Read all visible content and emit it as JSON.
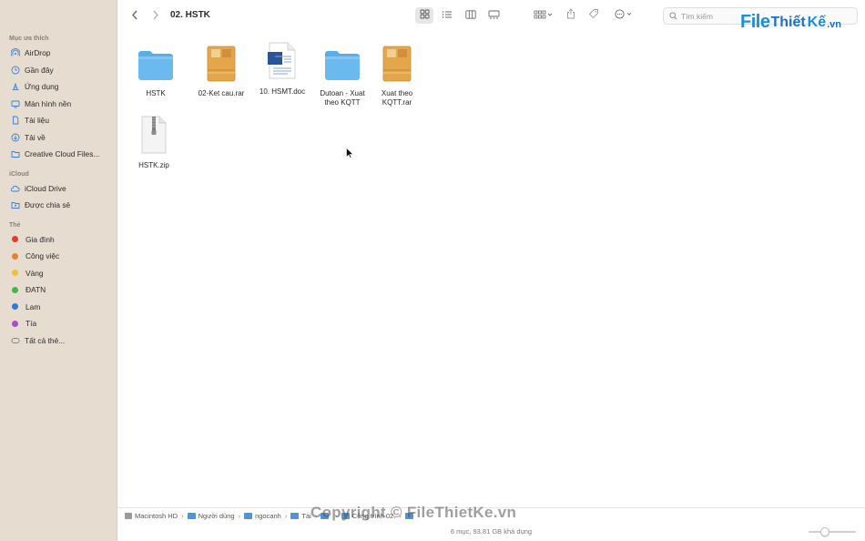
{
  "sidebar": {
    "favorites_heading": "Mục ưa thích",
    "favorites": [
      {
        "label": "AirDrop",
        "icon": "airdrop-icon"
      },
      {
        "label": "Gần đây",
        "icon": "clock-icon"
      },
      {
        "label": "Ứng dụng",
        "icon": "applications-icon"
      },
      {
        "label": "Màn hình nền",
        "icon": "desktop-icon"
      },
      {
        "label": "Tài liệu",
        "icon": "document-icon"
      },
      {
        "label": "Tải về",
        "icon": "download-icon"
      },
      {
        "label": "Creative Cloud Files...",
        "icon": "folder-icon"
      }
    ],
    "icloud_heading": "iCloud",
    "icloud": [
      {
        "label": "iCloud Drive",
        "icon": "cloud-icon"
      },
      {
        "label": "Được chia sẻ",
        "icon": "shared-folder-icon"
      }
    ],
    "tags_heading": "Thẻ",
    "tags": [
      {
        "label": "Gia đình",
        "color": "#e5392f"
      },
      {
        "label": "Công việc",
        "color": "#f07f2a"
      },
      {
        "label": "Vàng",
        "color": "#f2c12e"
      },
      {
        "label": "ĐATN",
        "color": "#3fb84a"
      },
      {
        "label": "Lam",
        "color": "#2f79d8"
      },
      {
        "label": "Tía",
        "color": "#a84dcc"
      },
      {
        "label": "Tất cả thẻ...",
        "color": ""
      }
    ]
  },
  "toolbar": {
    "back_icon": "chevron-left-icon",
    "forward_icon": "chevron-right-icon",
    "title": "02. HSTK",
    "search_placeholder": "Tìm kiếm"
  },
  "logo": {
    "part1": "File",
    "part2": "Thiết",
    "part3": "Kế",
    "part4": ".vn"
  },
  "files": [
    {
      "name": "HSTK",
      "type": "folder"
    },
    {
      "name": "02-Ket cau.rar",
      "type": "rar",
      "badge": "RAR"
    },
    {
      "name": "10. HSMT.doc",
      "type": "doc"
    },
    {
      "name": "Dutoan - Xuat theo KQTT",
      "type": "folder"
    },
    {
      "name": "Xuat theo KQTT.rar",
      "type": "rar",
      "badge": "RAR"
    },
    {
      "name": "HSTK.zip",
      "type": "zip",
      "badge": "ZIP"
    }
  ],
  "pathbar": [
    {
      "label": "Macintosh HD",
      "kind": "disk"
    },
    {
      "label": "Người dùng",
      "kind": "folder"
    },
    {
      "label": "ngocanh",
      "kind": "folder"
    },
    {
      "label": "Tài",
      "kind": "folder"
    },
    {
      "label": "",
      "kind": "folder"
    },
    {
      "label": "Công trình 02.",
      "kind": "folder"
    },
    {
      "label": "",
      "kind": "folder"
    }
  ],
  "status": "6 mục, 93,81 GB khả dụng",
  "zoom_level": 0.3,
  "watermark": "Copyright © FileThietKe.vn"
}
